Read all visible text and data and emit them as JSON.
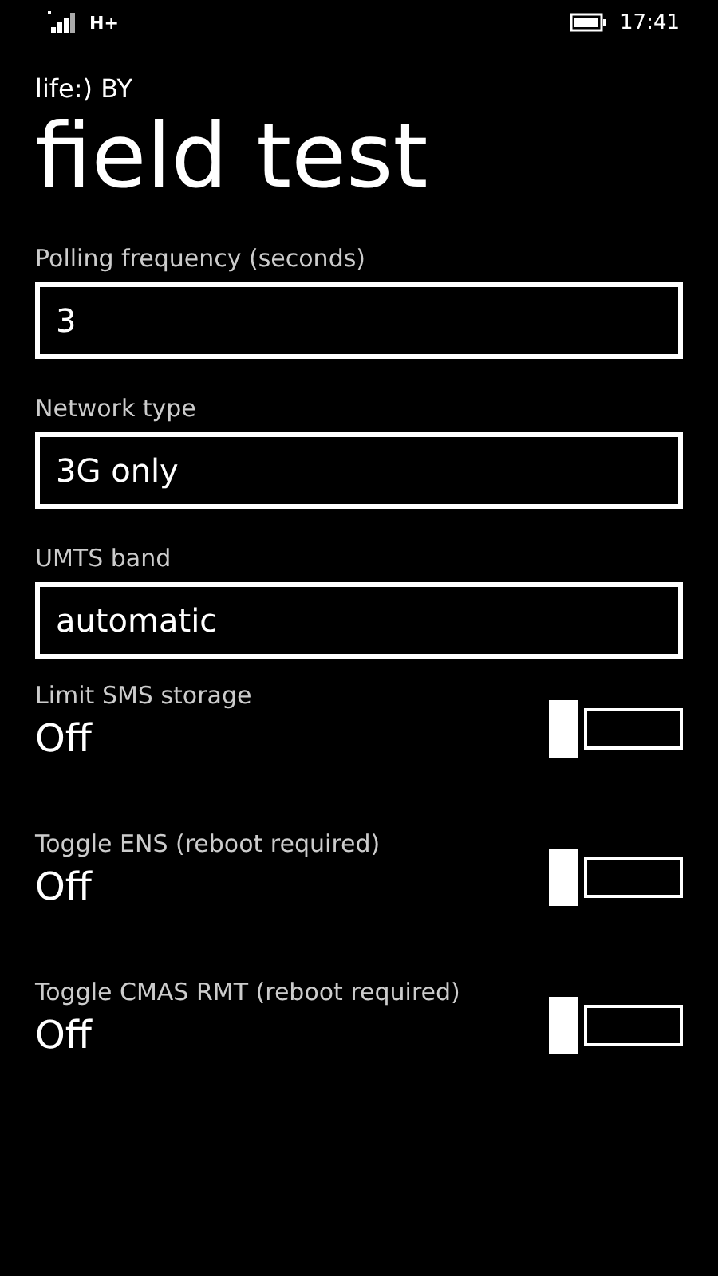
{
  "status_bar": {
    "network": "H+",
    "time": "17:41"
  },
  "app_name": "life:) BY",
  "title": "field test",
  "fields": [
    {
      "label": "Polling frequency (seconds)",
      "value": "3"
    },
    {
      "label": "Network type",
      "value": "3G only"
    },
    {
      "label": "UMTS band",
      "value": "automatic"
    }
  ],
  "toggles": [
    {
      "label": "Limit SMS storage",
      "state": "Off",
      "on": false
    },
    {
      "label": "Toggle ENS (reboot required)",
      "state": "Off",
      "on": false
    },
    {
      "label": "Toggle CMAS RMT (reboot required)",
      "state": "Off",
      "on": false
    }
  ]
}
